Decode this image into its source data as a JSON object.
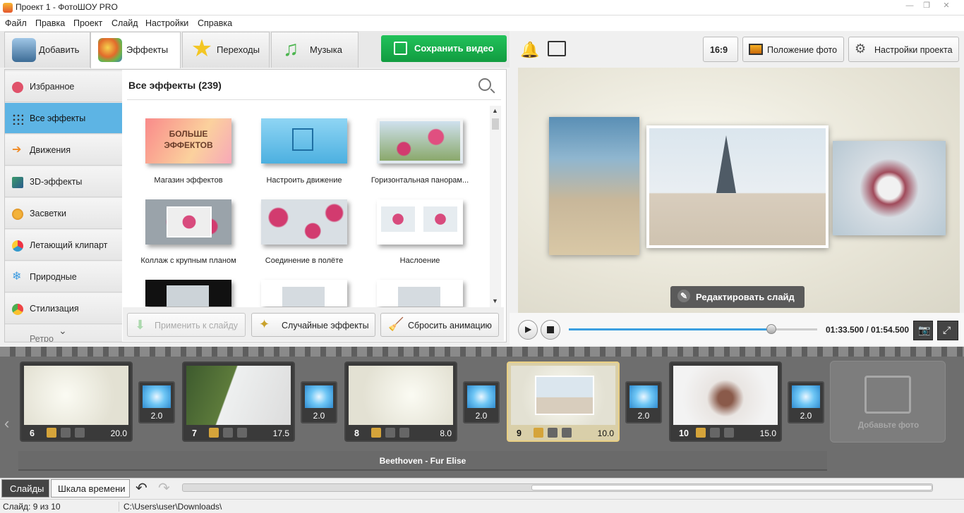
{
  "app": {
    "title": "Проект 1 - ФотоШОУ PRO"
  },
  "menu": [
    "Файл",
    "Правка",
    "Проект",
    "Слайд",
    "Настройки",
    "Справка"
  ],
  "tabs": [
    {
      "label": "Добавить",
      "icon": "camera-icon"
    },
    {
      "label": "Эффекты",
      "icon": "palette-icon",
      "active": true
    },
    {
      "label": "Переходы",
      "icon": "star-icon"
    },
    {
      "label": "Музыка",
      "icon": "music-note-icon"
    }
  ],
  "save_button": "Сохранить видео",
  "right_toolbar": {
    "ratio": "16:9",
    "photo_position": "Положение фото",
    "project_settings": "Настройки проекта"
  },
  "categories": [
    "Избранное",
    "Все эффекты",
    "Движения",
    "3D-эффекты",
    "Засветки",
    "Летающий клипарт",
    "Природные",
    "Стилизация",
    "Ретро"
  ],
  "effects": {
    "heading": "Все эффекты (239)",
    "store_badge": "БОЛЬШЕ ЭФФЕКТОВ",
    "items": [
      "Магазин эффектов",
      "Настроить движение",
      "Горизонтальная панорам...",
      "Коллаж с крупным планом",
      "Соединение в полёте",
      "Наслоение"
    ]
  },
  "bottom_buttons": {
    "apply": "Применить к слайду",
    "random": "Случайные эффекты",
    "reset": "Сбросить анимацию"
  },
  "preview": {
    "edit_slide": "Редактировать слайд",
    "time": "01:33.500 / 01:54.500",
    "progress": 0.816
  },
  "slides": [
    {
      "num": "6",
      "dur": "20.0"
    },
    {
      "num": "7",
      "dur": "17.5"
    },
    {
      "num": "8",
      "dur": "8.0"
    },
    {
      "num": "9",
      "dur": "10.0",
      "selected": true
    },
    {
      "num": "10",
      "dur": "15.0"
    }
  ],
  "transitions": [
    "2.0",
    "2.0",
    "2.0",
    "2.0",
    "2.0"
  ],
  "add_photo": "Добавьте фото",
  "music_track": "Beethoven - Fur Elise",
  "bottom_tabs": {
    "slides": "Слайды",
    "timeline": "Шкала времени"
  },
  "status": {
    "slide": "Слайд: 9 из 10",
    "path": "C:\\Users\\user\\Downloads\\"
  }
}
